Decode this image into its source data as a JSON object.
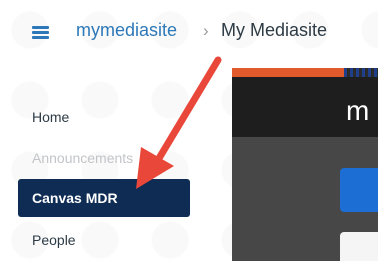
{
  "breadcrumb": {
    "root": "mymediasite",
    "separator": "›",
    "current": "My Mediasite"
  },
  "nav": {
    "items": [
      {
        "label": "Home",
        "state": "normal"
      },
      {
        "label": "Announcements",
        "state": "disabled"
      },
      {
        "label": "Canvas MDR",
        "state": "active"
      },
      {
        "label": "People",
        "state": "normal"
      }
    ]
  },
  "panel": {
    "header_letter": "m"
  },
  "colors": {
    "link": "#2d78b8",
    "active_nav_bg": "#0f2c54",
    "arrow": "#e8473a",
    "panel_accent": "#e05a2b",
    "panel_button": "#1c6ed4"
  },
  "icons": {
    "menu": "hamburger-icon",
    "annotation": "red-arrow-annotation"
  }
}
